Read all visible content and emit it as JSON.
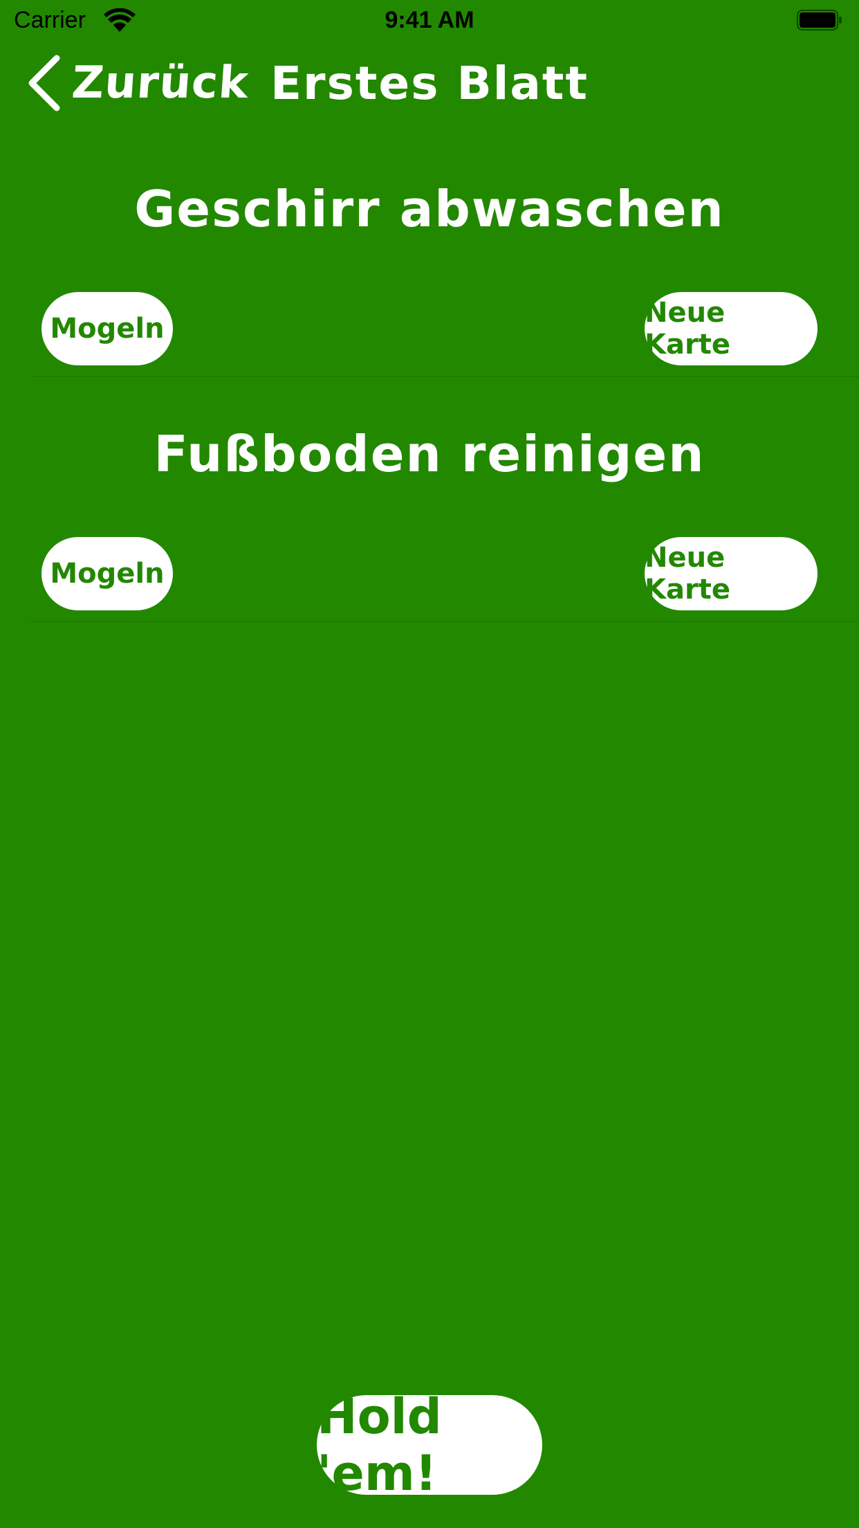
{
  "status_bar": {
    "carrier": "Carrier",
    "time": "9:41 AM"
  },
  "nav": {
    "back_label": "Zurück",
    "title": "Erstes Blatt"
  },
  "tasks": [
    {
      "title": "Geschirr abwaschen",
      "cheat_label": "Mogeln",
      "new_card_label": "Neue Karte"
    },
    {
      "title": "Fußboden reinigen",
      "cheat_label": "Mogeln",
      "new_card_label": "Neue Karte"
    }
  ],
  "hold_button": {
    "label": "Hold 'em!"
  },
  "colors": {
    "background": "#228800",
    "button_bg": "#ffffff",
    "button_text": "#228800",
    "text": "#ffffff"
  }
}
